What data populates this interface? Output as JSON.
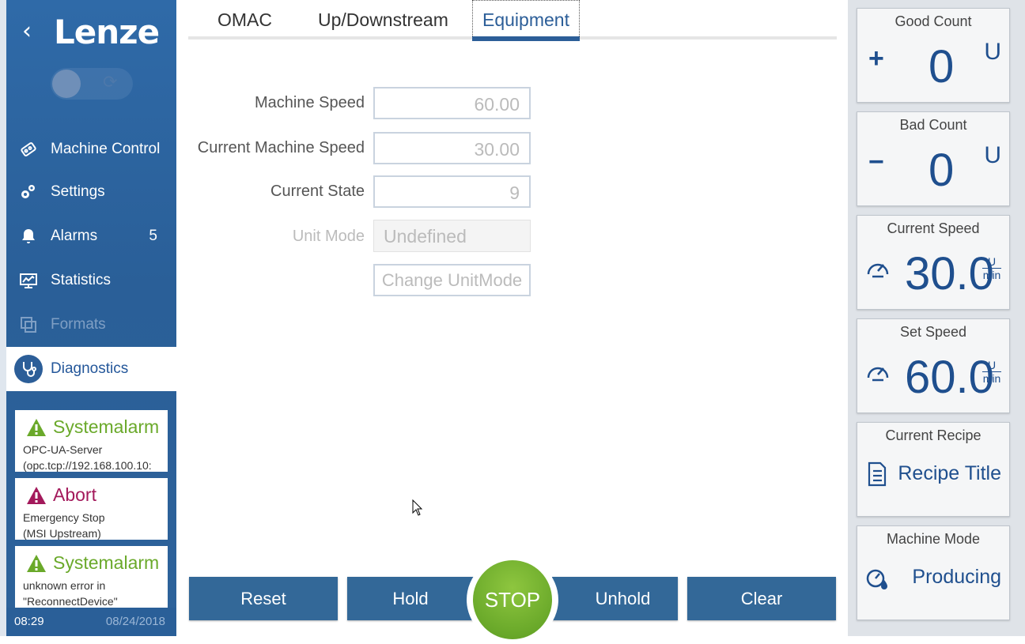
{
  "brand": "Lenze",
  "sidebar": {
    "items": [
      {
        "label": "Machine Control",
        "icon": "machine-control-icon"
      },
      {
        "label": "Settings",
        "icon": "gears-icon"
      },
      {
        "label": "Alarms",
        "icon": "bell-icon",
        "count": "5"
      },
      {
        "label": "Statistics",
        "icon": "chart-monitor-icon"
      },
      {
        "label": "Formats",
        "icon": "formats-icon",
        "disabled": true
      },
      {
        "label": "Diagnostics",
        "icon": "stethoscope-icon",
        "active": true
      }
    ],
    "alarms": [
      {
        "title": "Systemalarm",
        "line1": "OPC-UA-Server",
        "line2": "(opc.tcp://192.168.100.10:",
        "color": "#6aa92a"
      },
      {
        "title": "Abort",
        "line1": "Emergency Stop",
        "line2": "(MSI Upstream)",
        "color": "#a3195b"
      },
      {
        "title": "Systemalarm",
        "line1": "unknown error in",
        "line2": "\"ReconnectDevice\"",
        "color": "#6aa92a"
      }
    ],
    "time": "08:29",
    "date": "08/24/2018"
  },
  "tabs": [
    {
      "label": "OMAC"
    },
    {
      "label": "Up/Downstream"
    },
    {
      "label": "Equipment",
      "active": true
    }
  ],
  "fields": {
    "machine_speed": {
      "label": "Machine Speed",
      "value": "60.00"
    },
    "current_machine_speed": {
      "label": "Current Machine Speed",
      "value": "30.00"
    },
    "current_state": {
      "label": "Current State",
      "value": "9"
    },
    "unit_mode": {
      "label": "Unit Mode",
      "value": "Undefined"
    },
    "change_unit_mode_label": "Change UnitMode"
  },
  "actions": {
    "reset": "Reset",
    "hold": "Hold",
    "stop": "STOP",
    "unhold": "Unhold",
    "clear": "Clear"
  },
  "tiles": {
    "good_count": {
      "title": "Good Count",
      "sign": "+",
      "value": "0",
      "unit": "U"
    },
    "bad_count": {
      "title": "Bad Count",
      "sign": "−",
      "value": "0",
      "unit": "U"
    },
    "current_speed": {
      "title": "Current Speed",
      "value": "30.0",
      "unit_num": "U",
      "unit_den": "min"
    },
    "set_speed": {
      "title": "Set Speed",
      "value": "60.0",
      "unit_num": "U",
      "unit_den": "min"
    },
    "current_recipe": {
      "title": "Current Recipe",
      "value": "Recipe Title"
    },
    "machine_mode": {
      "title": "Machine Mode",
      "value": "Producing"
    }
  },
  "colors": {
    "primary": "#2c5e98",
    "stop": "#6aa92a",
    "alarm_warning": "#6aa92a",
    "alarm_abort": "#a3195b"
  }
}
